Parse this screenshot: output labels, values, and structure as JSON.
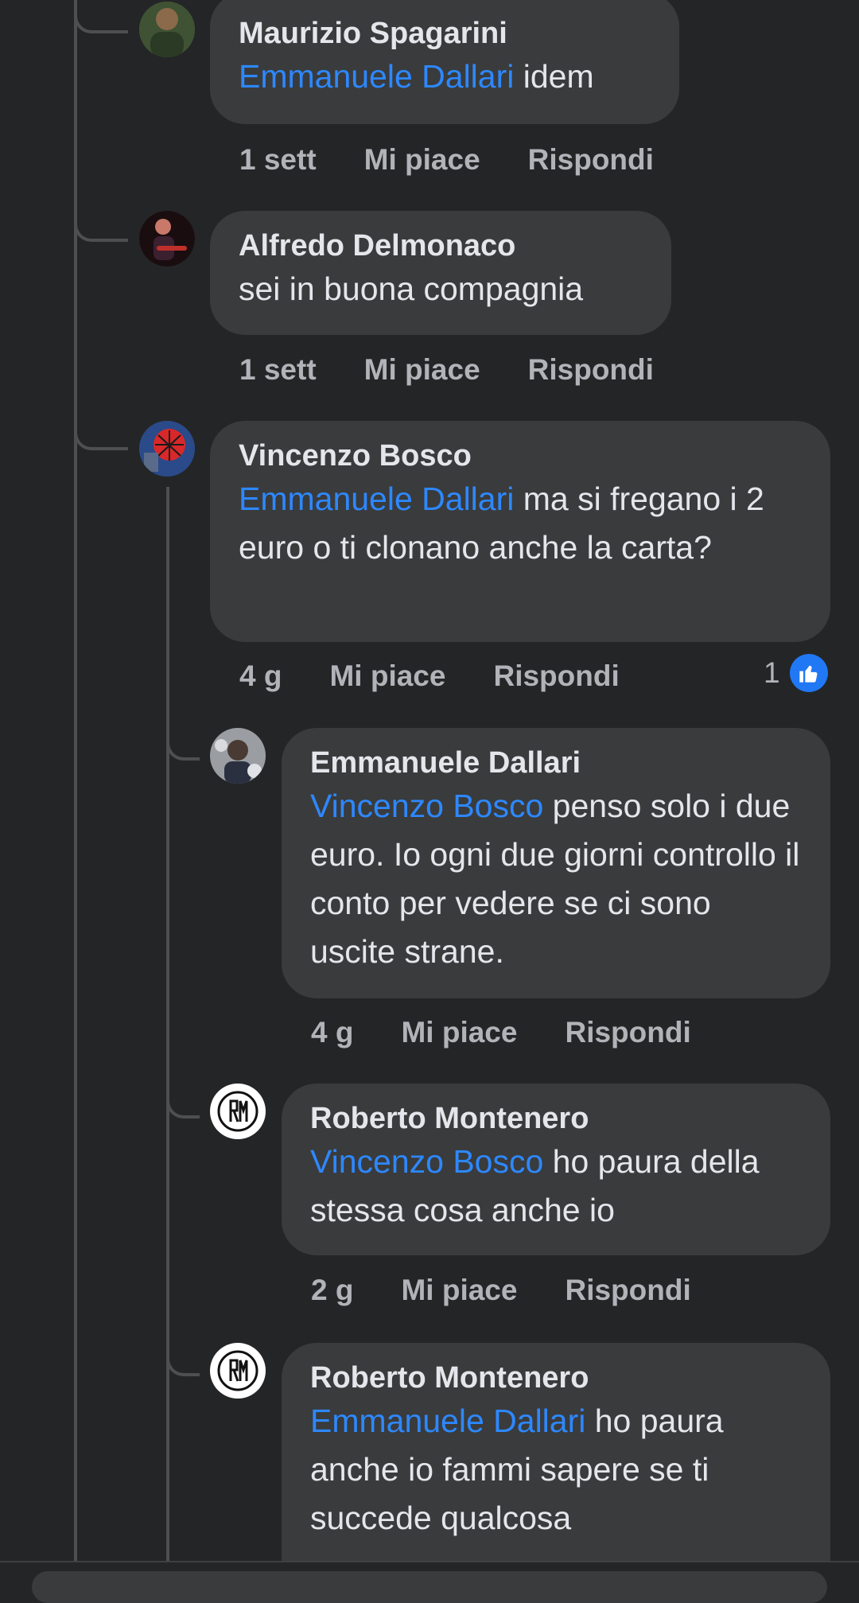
{
  "comments": [
    {
      "author": "Maurizio Spagarini",
      "mention": "Emmanuele Dallari",
      "text": " idem",
      "time": "1 sett",
      "like": "Mi piace",
      "reply": "Rispondi",
      "avatar_icon": "user-avatar-icon"
    },
    {
      "author": "Alfredo Delmonaco",
      "mention": "",
      "text": "sei in buona compagnia",
      "time": "1 sett",
      "like": "Mi piace",
      "reply": "Rispondi",
      "avatar_icon": "user-avatar-icon"
    },
    {
      "author": "Vincenzo Bosco",
      "mention": "Emmanuele Dallari",
      "text": " ma si fregano i 2 euro o ti clonano anche la carta?",
      "time": "4 g",
      "like": "Mi piace",
      "reply": "Rispondi",
      "reaction_count": "1",
      "reaction_icon": "thumbs-up-icon",
      "avatar_icon": "user-avatar-icon"
    },
    {
      "author": "Emmanuele Dallari",
      "mention": "Vincenzo Bosco",
      "text": " penso solo i due euro. Io ogni due giorni controllo il conto per vedere se ci sono uscite strane.",
      "time": "4 g",
      "like": "Mi piace",
      "reply": "Rispondi",
      "avatar_icon": "user-avatar-icon"
    },
    {
      "author": "Roberto Montenero",
      "mention": "Vincenzo Bosco",
      "text": " ho paura della stessa cosa anche io",
      "time": "2 g",
      "like": "Mi piace",
      "reply": "Rispondi",
      "avatar_icon": "rm-logo-icon"
    },
    {
      "author": "Roberto Montenero",
      "mention": "Emmanuele Dallari",
      "text": " ho paura anche io fammi sapere se ti succede qualcosa",
      "avatar_icon": "rm-logo-icon"
    }
  ],
  "colors": {
    "background": "#242526",
    "bubble": "#3a3b3c",
    "mention": "#2d88ff",
    "meta": "#b0b3b8",
    "like_badge": "#2078f4"
  }
}
